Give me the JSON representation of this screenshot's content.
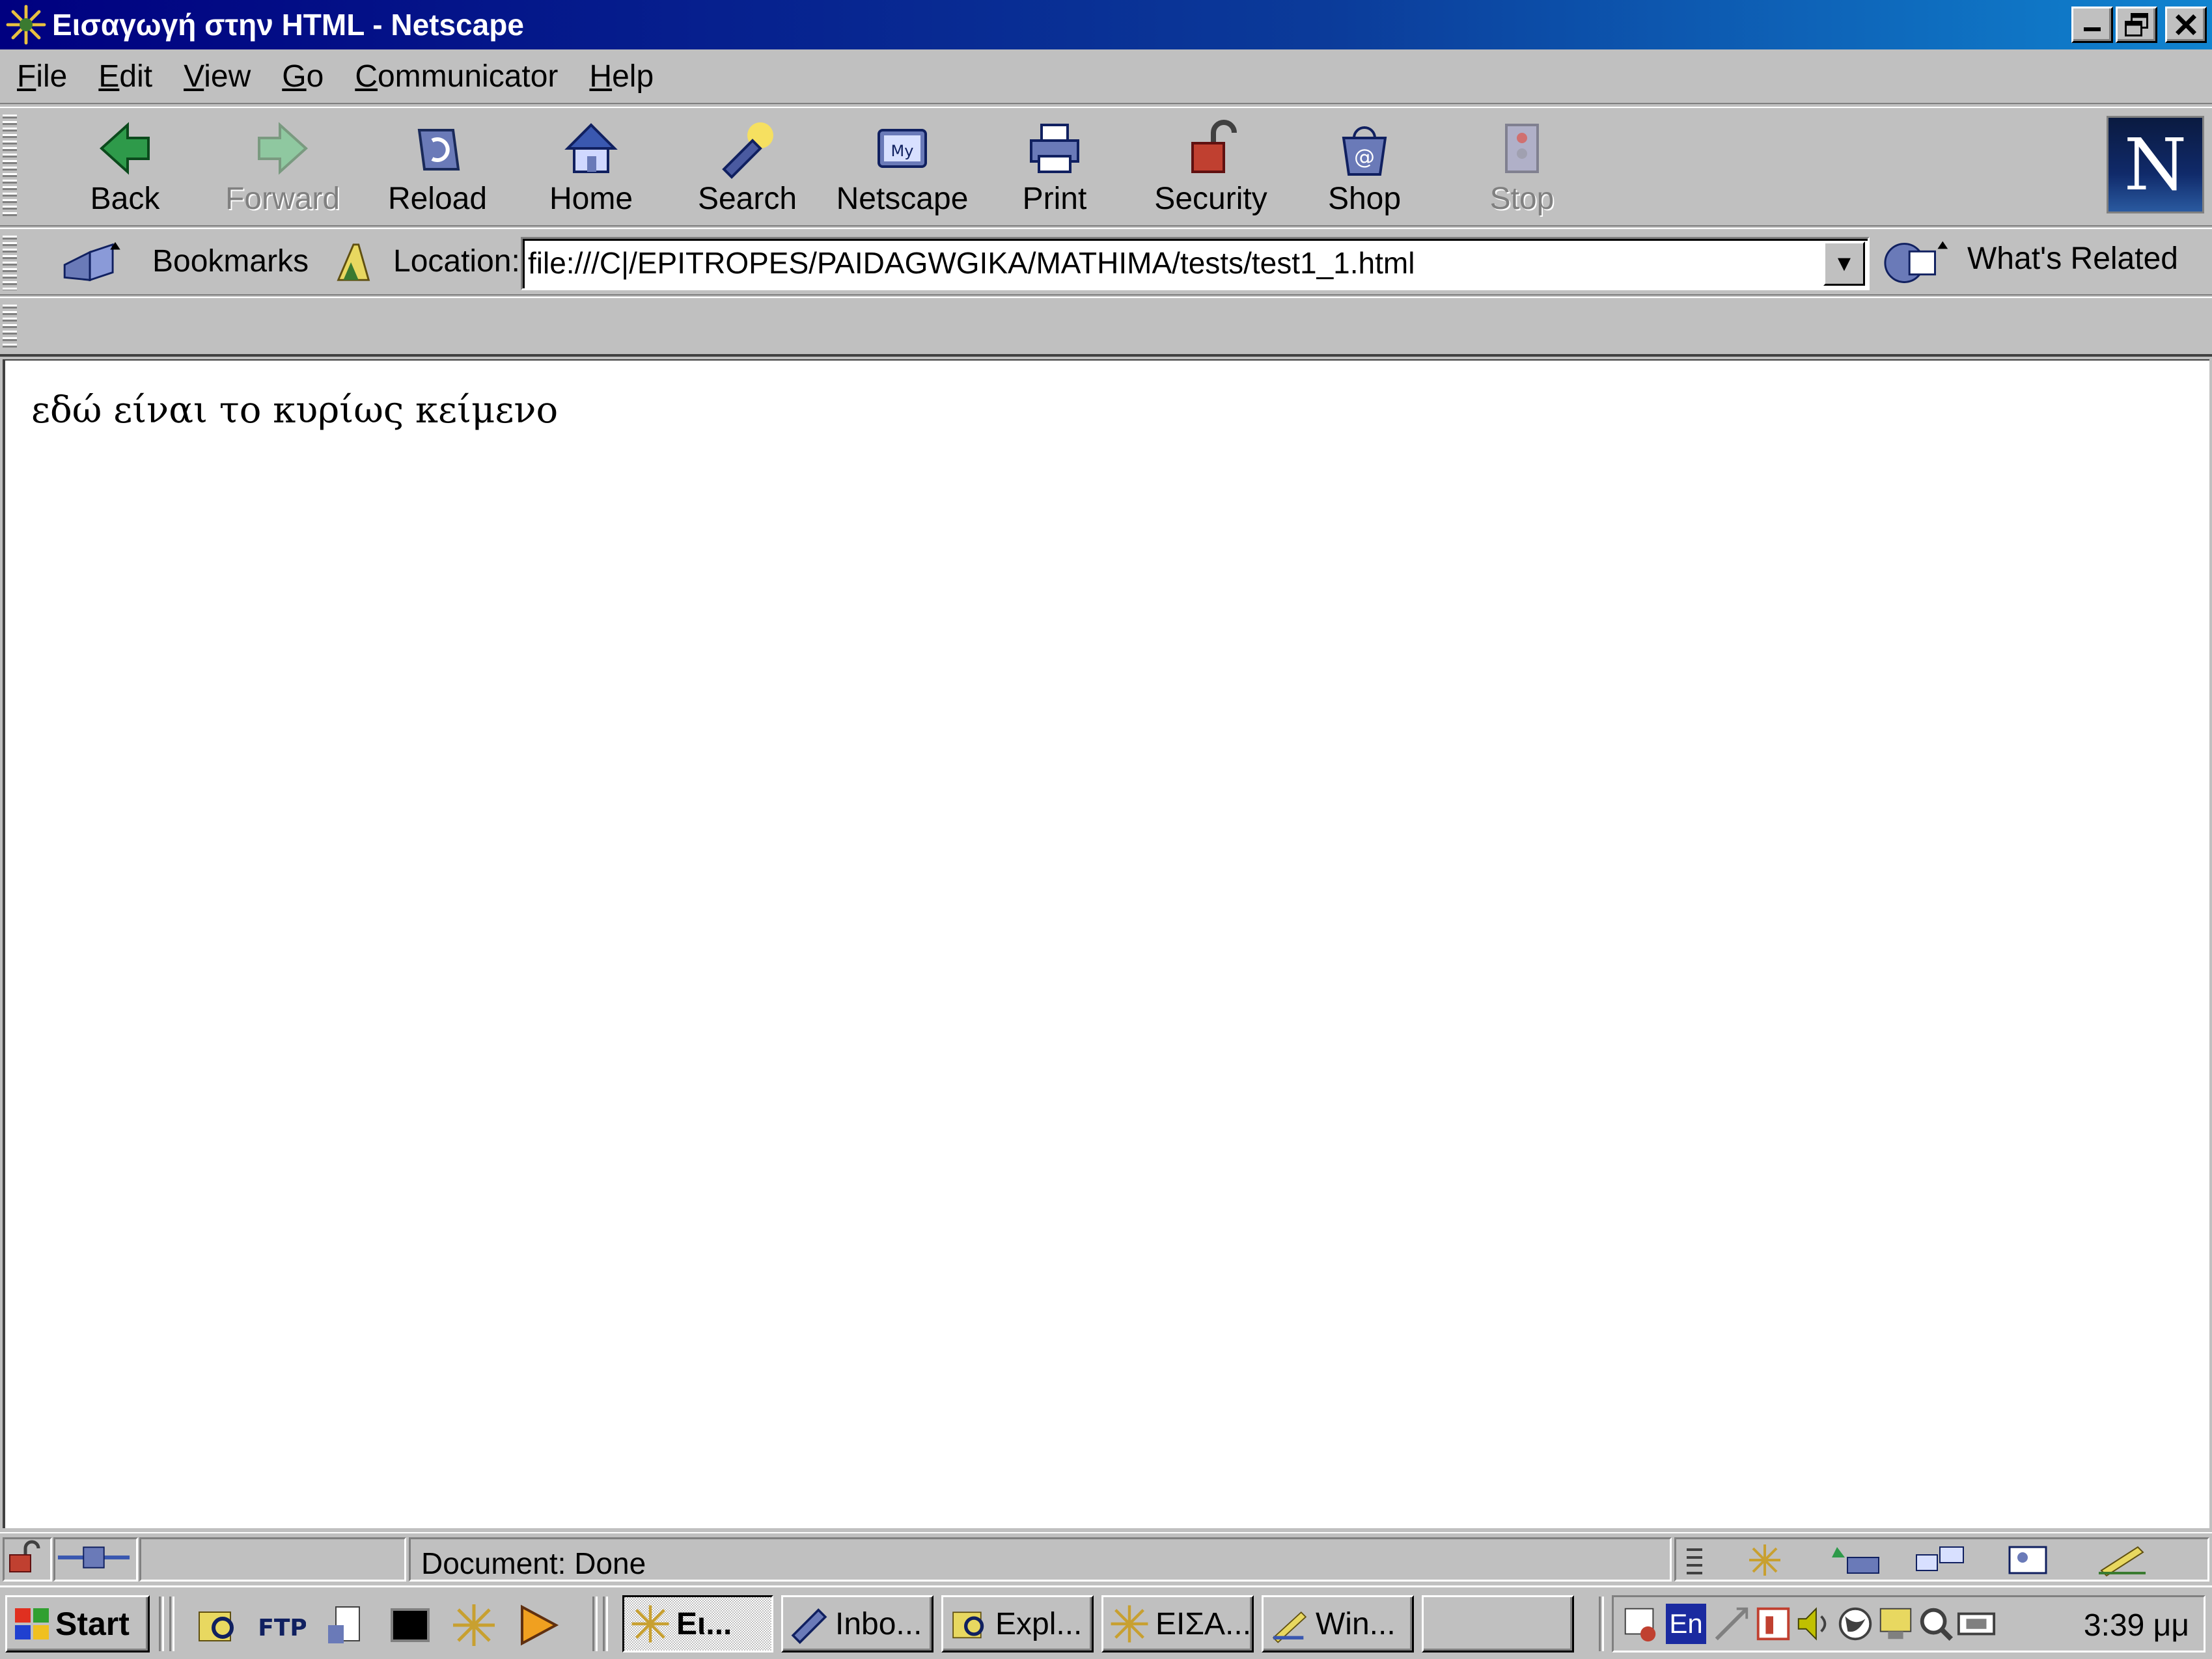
{
  "window": {
    "title": "Εισαγωγή στην HTML - Netscape",
    "controls": {
      "minimize": "_",
      "maximize": "▫",
      "close": "×"
    }
  },
  "menu": [
    {
      "label": "File"
    },
    {
      "label": "Edit"
    },
    {
      "label": "View"
    },
    {
      "label": "Go"
    },
    {
      "label": "Communicator"
    },
    {
      "label": "Help"
    }
  ],
  "toolbar": {
    "back": "Back",
    "forward": "Forward",
    "reload": "Reload",
    "home": "Home",
    "search": "Search",
    "netscape": "Netscape",
    "print": "Print",
    "security": "Security",
    "shop": "Shop",
    "stop": "Stop",
    "logo": "N"
  },
  "location_bar": {
    "bookmarks_label": "Bookmarks",
    "location_label": "Location:",
    "url": "file:///C|/EPITROPES/PAIDAGWGIKA/MATHIMA/tests/test1_1.html",
    "whats_related": "What's Related"
  },
  "page": {
    "body_text": "εδώ είναι το κυρίως κείμενο"
  },
  "status": {
    "text": "Document: Done"
  },
  "taskbar": {
    "start": "Start",
    "tasks": [
      {
        "label": "Ει...",
        "icon": "netscape-icon",
        "active": true
      },
      {
        "label": "Inbo...",
        "icon": "mail-icon",
        "active": false
      },
      {
        "label": "Expl...",
        "icon": "explorer-icon",
        "active": false
      },
      {
        "label": "ΕΙΣΑ...",
        "icon": "netscape-icon",
        "active": false
      },
      {
        "label": "Win...",
        "icon": "app-icon",
        "active": false
      },
      {
        "label": "",
        "icon": "",
        "active": false
      }
    ],
    "tray": {
      "language": "En",
      "clock": "3:39 μμ"
    }
  },
  "colors": {
    "titlebar_start": "#000080",
    "titlebar_end": "#1084d0",
    "chrome": "#c0c0c0",
    "content_bg": "#ffffff"
  }
}
